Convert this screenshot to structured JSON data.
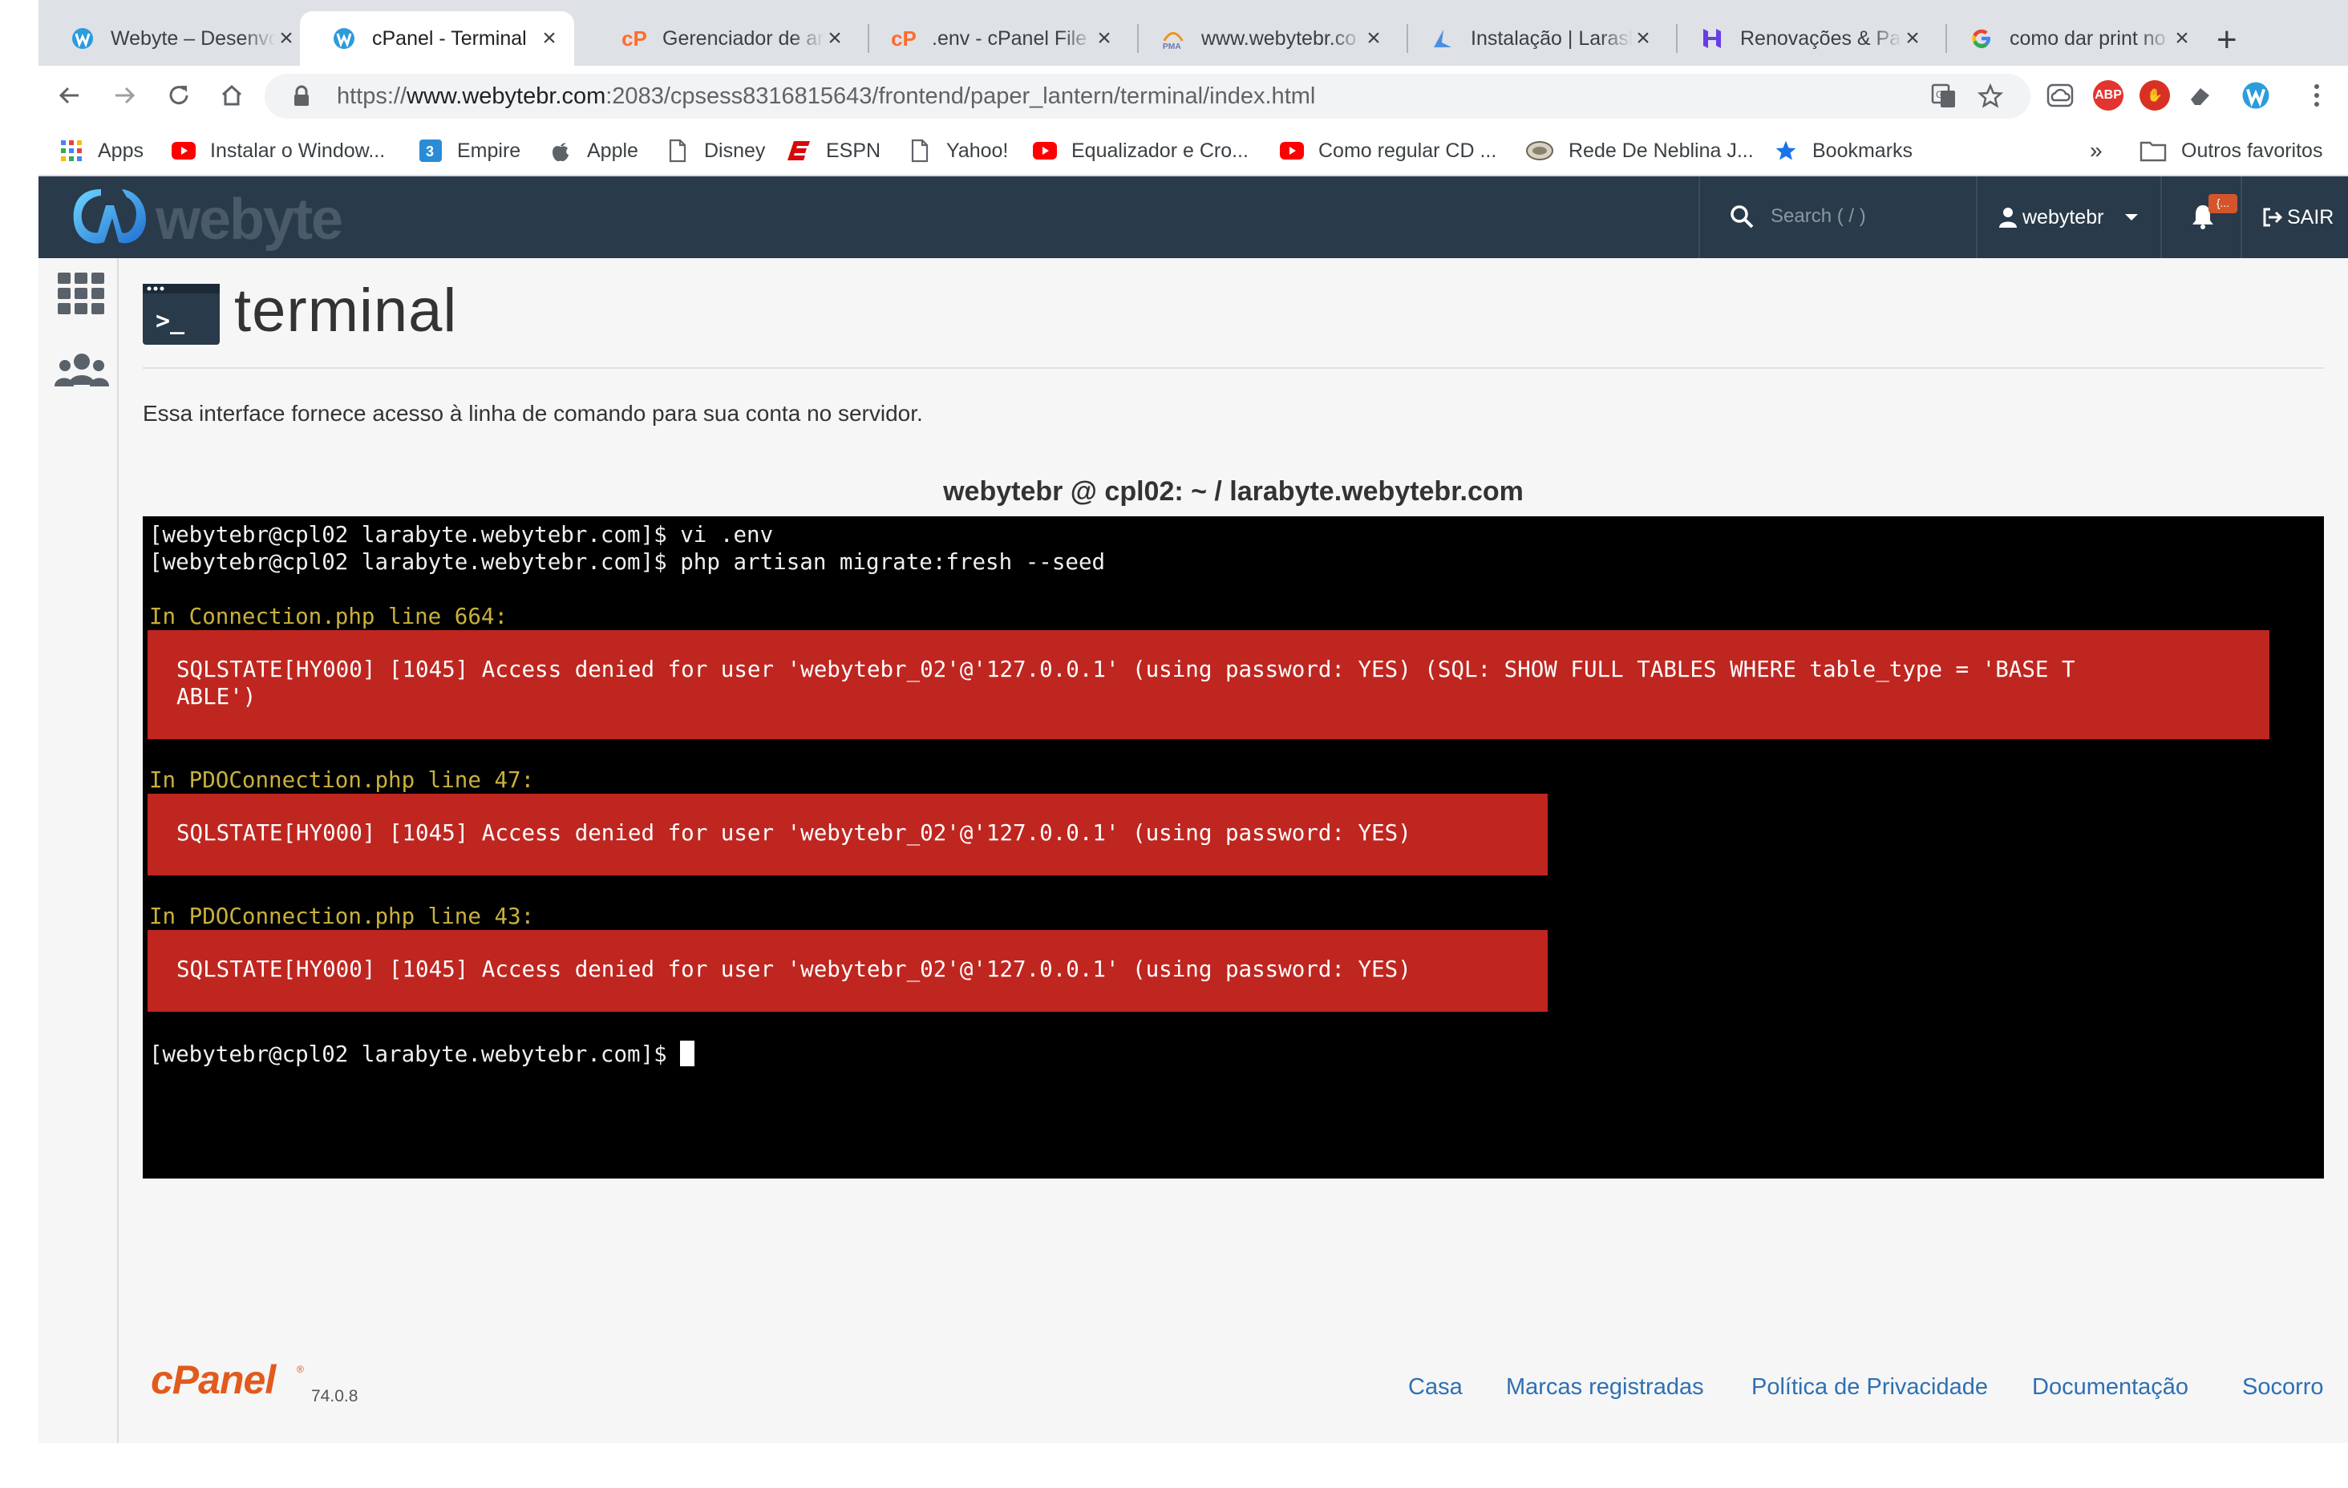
{
  "browser": {
    "tabs": [
      {
        "label": "Webyte – Desenvo",
        "icon": "webyte-icon",
        "active": false
      },
      {
        "label": "cPanel - Terminal",
        "icon": "webyte-icon",
        "active": true
      },
      {
        "label": "Gerenciador de ar",
        "icon": "cpanel-icon",
        "active": false
      },
      {
        "label": ".env - cPanel File",
        "icon": "cpanel-icon",
        "active": false
      },
      {
        "label": "www.webytebr.co",
        "icon": "phpmyadmin-icon",
        "active": false
      },
      {
        "label": "Instalação | Larasl",
        "icon": "larashop-icon",
        "active": false
      },
      {
        "label": "Renovações & Pag",
        "icon": "hostinger-icon",
        "active": false
      },
      {
        "label": "como dar print no",
        "icon": "google-icon",
        "active": false
      }
    ],
    "url": {
      "scheme": "https://",
      "host": "www.webytebr.com",
      "rest": ":2083/cpsess8316815643/frontend/paper_lantern/terminal/index.html"
    },
    "bookmarks": [
      {
        "label": "Apps",
        "icon": "apps-grid-icon"
      },
      {
        "label": "Instalar o Window...",
        "icon": "youtube-icon"
      },
      {
        "label": "Empire",
        "icon": "empire-icon"
      },
      {
        "label": "Apple",
        "icon": "apple-icon"
      },
      {
        "label": "Disney",
        "icon": "page-icon"
      },
      {
        "label": "ESPN",
        "icon": "espn-icon"
      },
      {
        "label": "Yahoo!",
        "icon": "page-icon"
      },
      {
        "label": "Equalizador e Cro...",
        "icon": "youtube-icon"
      },
      {
        "label": "Como regular CD ...",
        "icon": "youtube-icon"
      },
      {
        "label": "Rede De Neblina J...",
        "icon": "fog-icon"
      },
      {
        "label": "Bookmarks",
        "icon": "star-icon"
      }
    ],
    "bookmarks_overflow": "»",
    "other_bookmarks": "Outros favoritos"
  },
  "cpanel": {
    "brand": "webyte",
    "search_placeholder": "Search ( / )",
    "user": "webytebr",
    "logout": "SAIR",
    "notification_badge": "{...",
    "page_title": "terminal",
    "description": "Essa interface fornece acesso à linha de comando para sua conta no servidor.",
    "terminal_title": "webytebr @ cpl02: ~ / larabyte.webytebr.com",
    "terminal": {
      "commands": [
        "[webytebr@cpl02 larabyte.webytebr.com]$ vi .env",
        "[webytebr@cpl02 larabyte.webytebr.com]$ php artisan migrate:fresh --seed"
      ],
      "errors": [
        {
          "location": "In Connection.php line 664:",
          "message_lines": [
            "SQLSTATE[HY000] [1045] Access denied for user 'webytebr_02'@'127.0.0.1' (using password: YES) (SQL: SHOW FULL TABLES WHERE table_type = 'BASE T",
            "ABLE')"
          ]
        },
        {
          "location": "In PDOConnection.php line 47:",
          "message_lines": [
            "SQLSTATE[HY000] [1045] Access denied for user 'webytebr_02'@'127.0.0.1' (using password: YES)"
          ]
        },
        {
          "location": "In PDOConnection.php line 43:",
          "message_lines": [
            "SQLSTATE[HY000] [1045] Access denied for user 'webytebr_02'@'127.0.0.1' (using password: YES)"
          ]
        }
      ],
      "prompt": "[webytebr@cpl02 larabyte.webytebr.com]$ "
    },
    "footer": {
      "logo": "cPanel",
      "version": "74.0.8",
      "links": [
        "Casa",
        "Marcas registradas",
        "Política de Privacidade",
        "Documentação",
        "Socorro"
      ]
    }
  },
  "colors": {
    "header": "#293a4a",
    "error_bg": "#bf2620",
    "warning_text": "#c9b03c",
    "link": "#2e70b3"
  }
}
